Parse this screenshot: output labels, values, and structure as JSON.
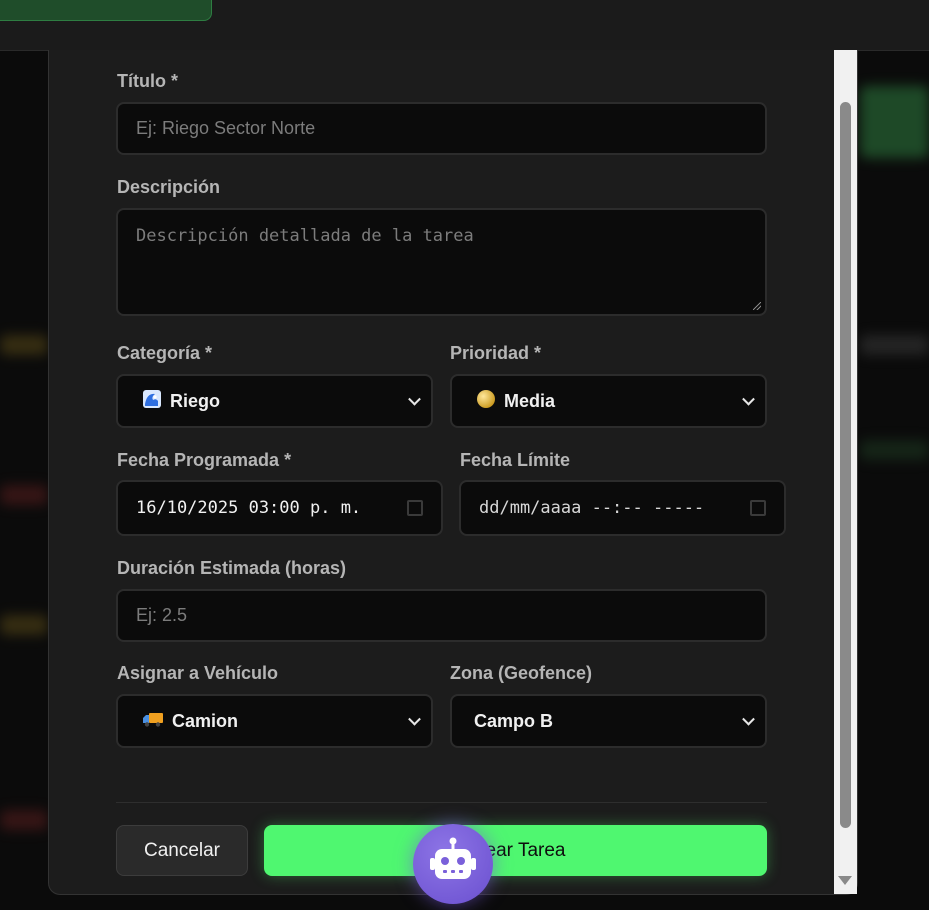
{
  "form": {
    "title_label": "Título *",
    "title_placeholder": "Ej: Riego Sector Norte",
    "description_label": "Descripción",
    "description_placeholder": "Descripción detallada de la tarea",
    "category_label": "Categoría *",
    "category_value": "Riego",
    "category_icon": "wave-icon",
    "priority_label": "Prioridad *",
    "priority_value": "Media",
    "priority_icon": "yellow-circle-icon",
    "scheduled_label": "Fecha Programada *",
    "scheduled_value": "16/10/2025 03:00 p. m.",
    "deadline_label": "Fecha Límite",
    "deadline_placeholder": "dd/mm/aaaa --:-- -----",
    "duration_label": "Duración Estimada (horas)",
    "duration_placeholder": "Ej: 2.5",
    "vehicle_label": "Asignar a Vehículo",
    "vehicle_value": "Camion",
    "vehicle_icon": "truck-icon",
    "zone_label": "Zona (Geofence)",
    "zone_value": "Campo B"
  },
  "actions": {
    "cancel_label": "Cancelar",
    "create_label": "Crear Tarea"
  },
  "colors": {
    "accent_green": "#4ff770",
    "modal_bg": "#1c1c1c",
    "field_bg": "#0b0b0b",
    "robot_purple": "#7a60da"
  }
}
